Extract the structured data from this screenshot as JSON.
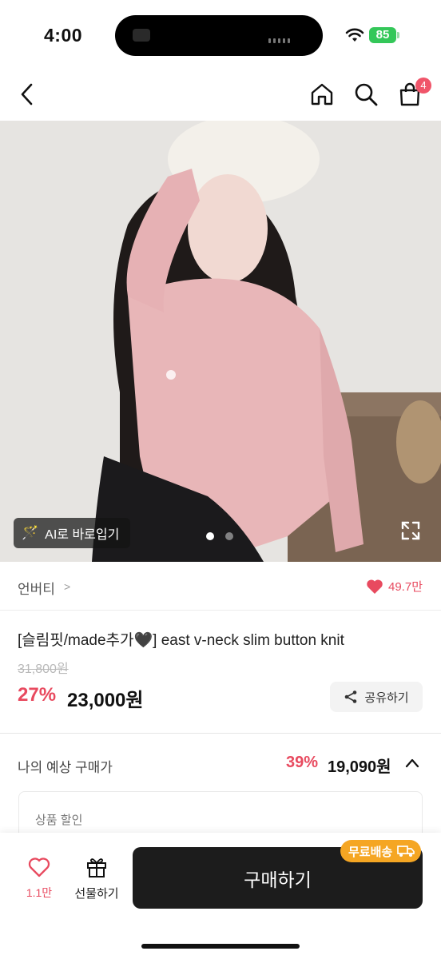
{
  "status_bar": {
    "time": "4:00",
    "battery": "85"
  },
  "nav": {
    "back_icon": "chevron-left-icon",
    "home_icon": "home-icon",
    "search_icon": "search-icon",
    "cart_icon": "shopping-bag-icon",
    "cart_count": "4"
  },
  "gallery": {
    "ai_shortcut_label": "AI로 바로입기",
    "total_slides": 2,
    "active_slide": 1
  },
  "brand": {
    "name": "언버티",
    "chevron": ">",
    "like_count": "49.7만"
  },
  "product": {
    "title": "[슬림핏/made추가🖤] east v-neck slim button knit",
    "original_price": "31,800원",
    "discount_rate": "27%",
    "sale_price": "23,000원",
    "share_label": "공유하기"
  },
  "expected_price": {
    "label": "나의 예상 구매가",
    "rate": "39%",
    "price": "19,090원"
  },
  "discount_section": {
    "label": "상품 할인"
  },
  "bottom_bar": {
    "wish_count": "1.1만",
    "gift_label": "선물하기",
    "buy_label": "구매하기",
    "free_shipping_label": "무료배송"
  },
  "colors": {
    "accent": "#e84a5f",
    "buy_button": "#1c1c1c",
    "free_shipping": "#f5a623",
    "battery": "#34c759"
  }
}
